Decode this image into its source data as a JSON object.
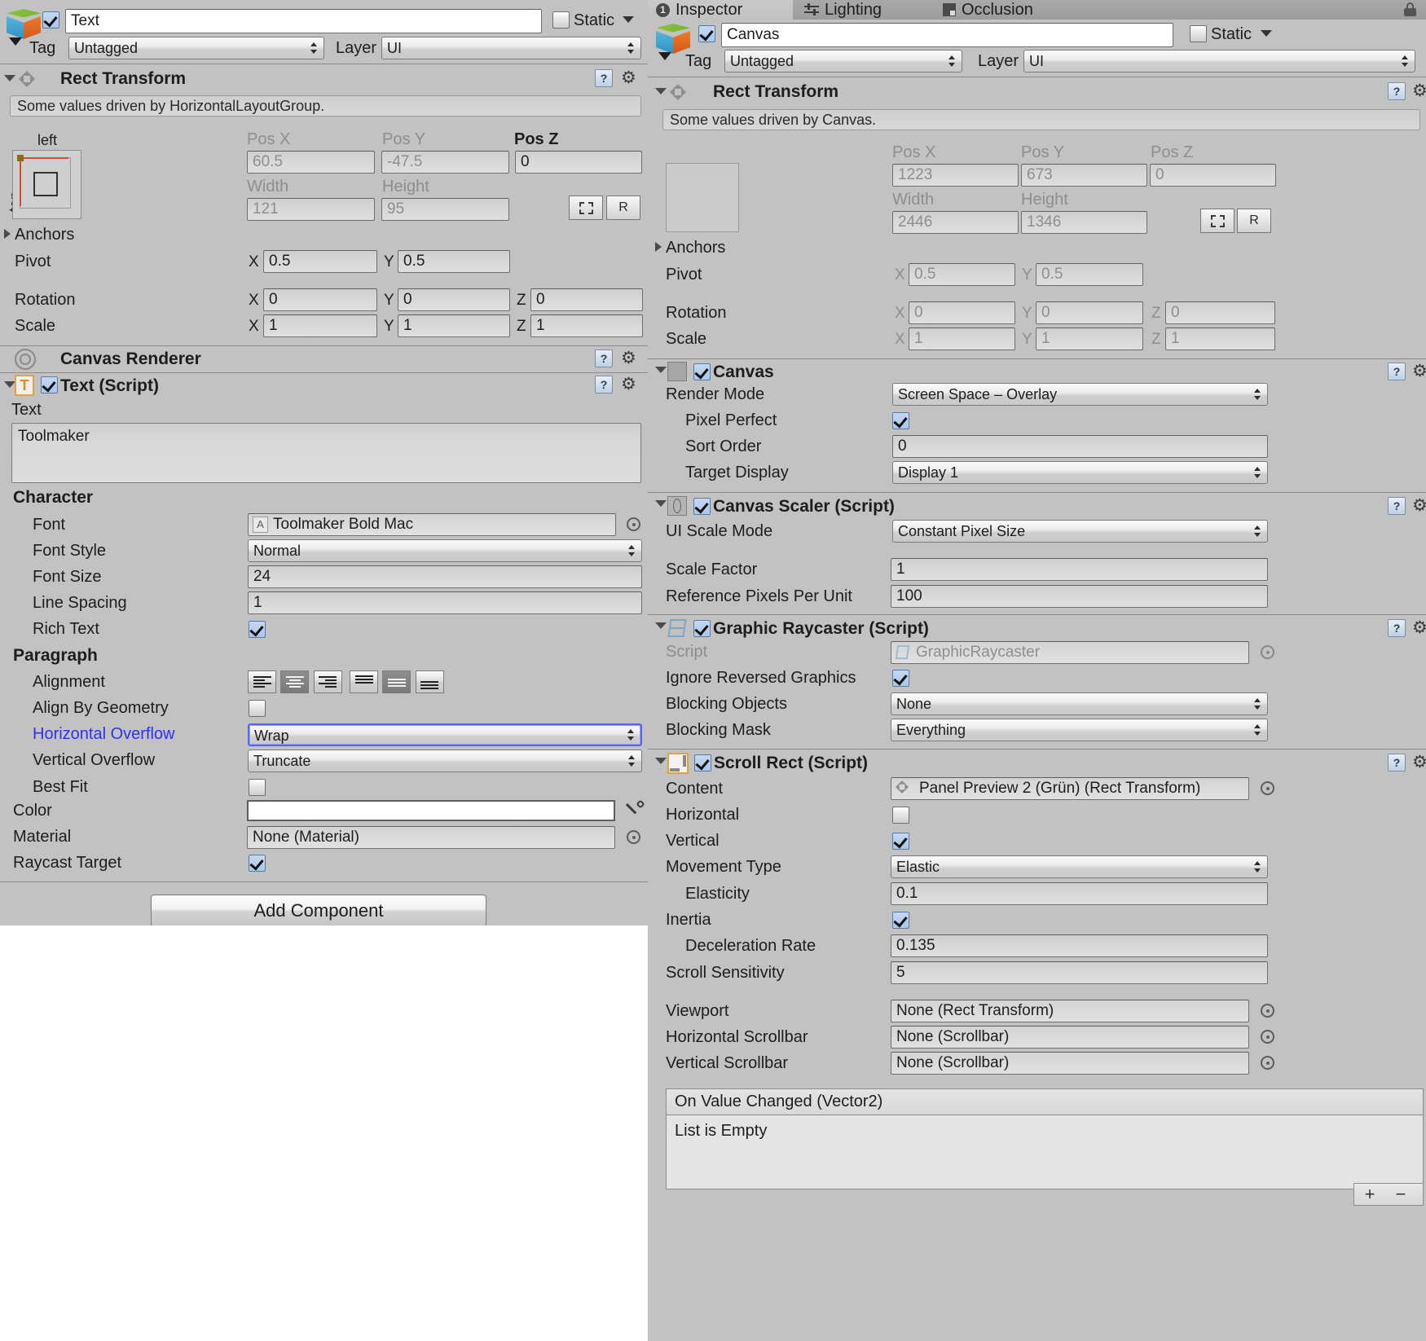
{
  "left_inspector": {
    "object_name": "Text",
    "object_enabled": true,
    "static_label": "Static",
    "static_checked": false,
    "tag_label": "Tag",
    "tag_value": "Untagged",
    "layer_label": "Layer",
    "layer_value": "UI",
    "rect_transform": {
      "title": "Rect Transform",
      "driven_note": "Some values driven by HorizontalLayoutGroup.",
      "anchor_left_label": "left",
      "anchor_top_label": "top",
      "pos_x_label": "Pos X",
      "pos_y_label": "Pos Y",
      "pos_z_label": "Pos Z",
      "pos_x": "60.5",
      "pos_y": "-47.5",
      "pos_z": "0",
      "width_label": "Width",
      "height_label": "Height",
      "width": "121",
      "height": "95",
      "blueprint_label": "R",
      "anchors_label": "Anchors",
      "pivot_label": "Pivot",
      "pivot_x": "0.5",
      "pivot_y": "0.5",
      "rotation_label": "Rotation",
      "rotation_x": "0",
      "rotation_y": "0",
      "rotation_z": "0",
      "scale_label": "Scale",
      "scale_x": "1",
      "scale_y": "1",
      "scale_z": "1",
      "axis_x": "X",
      "axis_y": "Y",
      "axis_z": "Z"
    },
    "canvas_renderer": {
      "title": "Canvas Renderer"
    },
    "text_script": {
      "title": "Text (Script)",
      "enabled": true,
      "text_label": "Text",
      "text_value": "Toolmaker",
      "character_header": "Character",
      "font_label": "Font",
      "font_value": "Toolmaker Bold Mac",
      "font_style_label": "Font Style",
      "font_style_value": "Normal",
      "font_size_label": "Font Size",
      "font_size_value": "24",
      "line_spacing_label": "Line Spacing",
      "line_spacing_value": "1",
      "rich_text_label": "Rich Text",
      "rich_text_checked": true,
      "paragraph_header": "Paragraph",
      "alignment_label": "Alignment",
      "alignment_horizontal_selected": 1,
      "alignment_vertical_selected": 1,
      "align_by_geometry_label": "Align By Geometry",
      "align_by_geometry_checked": false,
      "horizontal_overflow_label": "Horizontal Overflow",
      "horizontal_overflow_value": "Wrap",
      "vertical_overflow_label": "Vertical Overflow",
      "vertical_overflow_value": "Truncate",
      "best_fit_label": "Best Fit",
      "best_fit_checked": false,
      "color_label": "Color",
      "color_value": "#ffffff",
      "material_label": "Material",
      "material_value": "None (Material)",
      "raycast_target_label": "Raycast Target",
      "raycast_target_checked": true
    },
    "add_component_label": "Add Component"
  },
  "right_inspector": {
    "tabs": [
      {
        "label": "Inspector",
        "icon": "inspector-badge-icon",
        "active": true,
        "badge": "1"
      },
      {
        "label": "Lighting",
        "icon": "lighting-icon",
        "active": false
      },
      {
        "label": "Occlusion",
        "icon": "occlusion-icon",
        "active": false
      }
    ],
    "object_name": "Canvas",
    "object_enabled": true,
    "static_label": "Static",
    "static_checked": false,
    "tag_label": "Tag",
    "tag_value": "Untagged",
    "layer_label": "Layer",
    "layer_value": "UI",
    "rect_transform": {
      "title": "Rect Transform",
      "driven_note": "Some values driven by Canvas.",
      "pos_x_label": "Pos X",
      "pos_y_label": "Pos Y",
      "pos_z_label": "Pos Z",
      "pos_x": "1223",
      "pos_y": "673",
      "pos_z": "0",
      "width_label": "Width",
      "height_label": "Height",
      "width": "2446",
      "height": "1346",
      "blueprint_label": "R",
      "anchors_label": "Anchors",
      "pivot_label": "Pivot",
      "pivot_x": "0.5",
      "pivot_y": "0.5",
      "rotation_label": "Rotation",
      "rotation_x": "0",
      "rotation_y": "0",
      "rotation_z": "0",
      "scale_label": "Scale",
      "scale_x": "1",
      "scale_y": "1",
      "scale_z": "1",
      "axis_x": "X",
      "axis_y": "Y",
      "axis_z": "Z"
    },
    "canvas": {
      "title": "Canvas",
      "enabled": true,
      "render_mode_label": "Render Mode",
      "render_mode_value": "Screen Space – Overlay",
      "pixel_perfect_label": "Pixel Perfect",
      "pixel_perfect_checked": true,
      "sort_order_label": "Sort Order",
      "sort_order_value": "0",
      "target_display_label": "Target Display",
      "target_display_value": "Display 1"
    },
    "canvas_scaler": {
      "title": "Canvas Scaler (Script)",
      "enabled": true,
      "ui_scale_mode_label": "UI Scale Mode",
      "ui_scale_mode_value": "Constant Pixel Size",
      "scale_factor_label": "Scale Factor",
      "scale_factor_value": "1",
      "reference_ppu_label": "Reference Pixels Per Unit",
      "reference_ppu_value": "100"
    },
    "graphic_raycaster": {
      "title": "Graphic Raycaster (Script)",
      "enabled": true,
      "script_label": "Script",
      "script_value": "GraphicRaycaster",
      "ignore_reversed_label": "Ignore Reversed Graphics",
      "ignore_reversed_checked": true,
      "blocking_objects_label": "Blocking Objects",
      "blocking_objects_value": "None",
      "blocking_mask_label": "Blocking Mask",
      "blocking_mask_value": "Everything"
    },
    "scroll_rect": {
      "title": "Scroll Rect (Script)",
      "enabled": true,
      "content_label": "Content",
      "content_value": "Panel Preview 2 (Grün) (Rect Transform)",
      "horizontal_label": "Horizontal",
      "horizontal_checked": false,
      "vertical_label": "Vertical",
      "vertical_checked": true,
      "movement_type_label": "Movement Type",
      "movement_type_value": "Elastic",
      "elasticity_label": "Elasticity",
      "elasticity_value": "0.1",
      "inertia_label": "Inertia",
      "inertia_checked": true,
      "deceleration_label": "Deceleration Rate",
      "deceleration_value": "0.135",
      "scroll_sensitivity_label": "Scroll Sensitivity",
      "scroll_sensitivity_value": "5",
      "viewport_label": "Viewport",
      "viewport_value": "None (Rect Transform)",
      "h_scrollbar_label": "Horizontal Scrollbar",
      "h_scrollbar_value": "None (Scrollbar)",
      "v_scrollbar_label": "Vertical Scrollbar",
      "v_scrollbar_value": "None (Scrollbar)",
      "event_header": "On Value Changed (Vector2)",
      "event_empty": "List is Empty",
      "add_event_label": "+",
      "remove_event_label": "−"
    }
  },
  "colors": {
    "panel_bg": "#c2c2c2",
    "field_bg": "#d8d8d8",
    "link_blue": "#2c31f2",
    "focus_blue": "#5b63f0",
    "white": "#ffffff"
  }
}
